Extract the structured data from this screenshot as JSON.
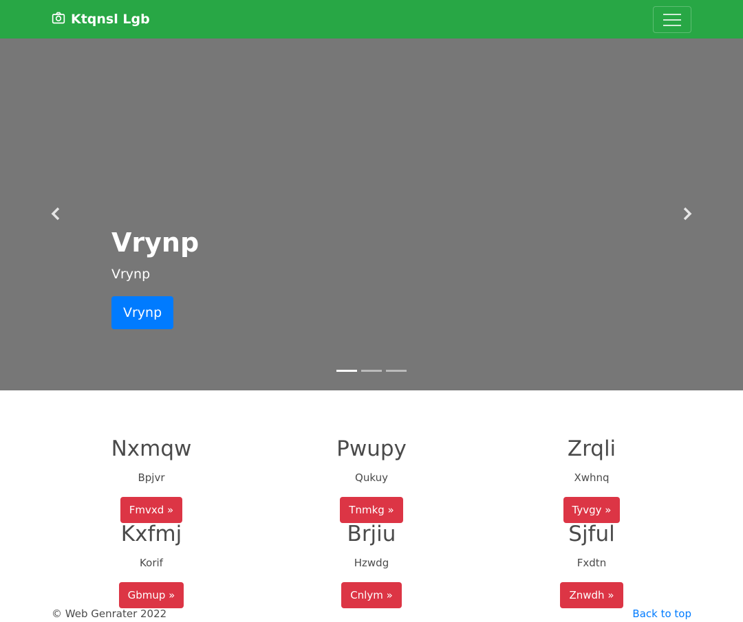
{
  "navbar": {
    "brand": "Ktqnsl Lgb",
    "brand_icon": "camera-icon",
    "toggler_icon": "hamburger-menu-icon",
    "background": "#28a745"
  },
  "carousel": {
    "background": "#777777",
    "title": "Vrynp",
    "subtitle": "Vrynp",
    "button_label": "Vrynp",
    "button_color": "#007bff",
    "prev_icon": "chevron-left-icon",
    "next_icon": "chevron-right-icon",
    "indicators": 3,
    "active_indicator": 0
  },
  "features": [
    {
      "title": "Nxmqw",
      "text": "Bpjvr",
      "button": "Fmvxd »"
    },
    {
      "title": "Pwupy",
      "text": "Qukuy",
      "button": "Tnmkg »"
    },
    {
      "title": "Zrqli",
      "text": "Xwhnq",
      "button": "Tyvgy »"
    },
    {
      "title": "Kxfmj",
      "text": "Korif",
      "button": "Gbmup »"
    },
    {
      "title": "Brjiu",
      "text": "Hzwdg",
      "button": "Cnlym »"
    },
    {
      "title": "Sjful",
      "text": "Fxdtn",
      "button": "Znwdh »"
    }
  ],
  "footer": {
    "copyright": "© Web Genrater 2022",
    "back_to_top": "Back to top"
  },
  "colors": {
    "feature_button": "#dc3545",
    "link": "#007bff"
  }
}
